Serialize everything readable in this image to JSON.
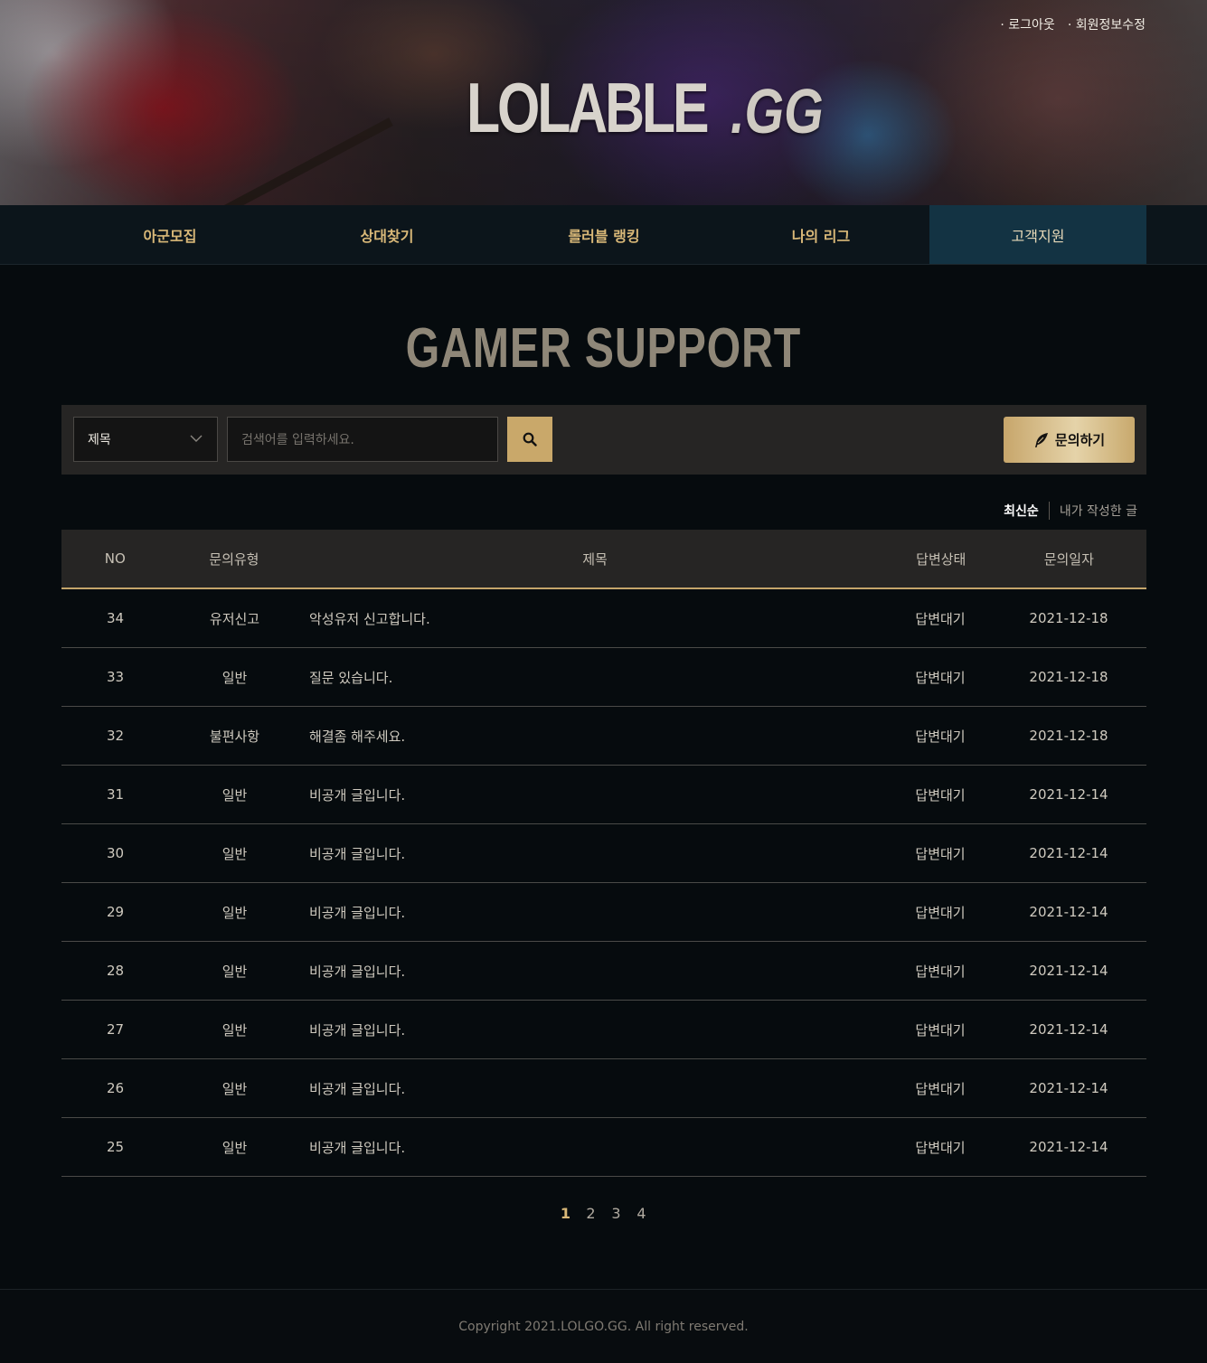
{
  "header": {
    "top_links": [
      "· 로그아웃",
      "· 회원정보수정"
    ],
    "logo_main": "LOLABLE",
    "logo_suffix": ".GG"
  },
  "nav": {
    "items": [
      "아군모집",
      "상대찾기",
      "롤러블 랭킹",
      "나의 리그",
      "고객지원"
    ],
    "active_index": 4
  },
  "page_title": "GAMER SUPPORT",
  "search": {
    "select_value": "제목",
    "placeholder": "검색어를 입력하세요.",
    "search_icon": "search-icon",
    "write_label": "문의하기",
    "write_icon": "quill-icon"
  },
  "sort": {
    "active": "최신순",
    "other": "내가 작성한 글"
  },
  "table": {
    "headers": [
      "NO",
      "문의유형",
      "제목",
      "답변상태",
      "문의일자"
    ],
    "rows": [
      {
        "no": "34",
        "type": "유저신고",
        "title": "악성유저 신고합니다.",
        "status": "답변대기",
        "date": "2021-12-18"
      },
      {
        "no": "33",
        "type": "일반",
        "title": "질문 있습니다.",
        "status": "답변대기",
        "date": "2021-12-18"
      },
      {
        "no": "32",
        "type": "불편사항",
        "title": "해결좀 해주세요.",
        "status": "답변대기",
        "date": "2021-12-18"
      },
      {
        "no": "31",
        "type": "일반",
        "title": "비공개 글입니다.",
        "status": "답변대기",
        "date": "2021-12-14"
      },
      {
        "no": "30",
        "type": "일반",
        "title": "비공개 글입니다.",
        "status": "답변대기",
        "date": "2021-12-14"
      },
      {
        "no": "29",
        "type": "일반",
        "title": "비공개 글입니다.",
        "status": "답변대기",
        "date": "2021-12-14"
      },
      {
        "no": "28",
        "type": "일반",
        "title": "비공개 글입니다.",
        "status": "답변대기",
        "date": "2021-12-14"
      },
      {
        "no": "27",
        "type": "일반",
        "title": "비공개 글입니다.",
        "status": "답변대기",
        "date": "2021-12-14"
      },
      {
        "no": "26",
        "type": "일반",
        "title": "비공개 글입니다.",
        "status": "답변대기",
        "date": "2021-12-14"
      },
      {
        "no": "25",
        "type": "일반",
        "title": "비공개 글입니다.",
        "status": "답변대기",
        "date": "2021-12-14"
      }
    ]
  },
  "pagination": {
    "pages": [
      "1",
      "2",
      "3",
      "4"
    ],
    "current": "1"
  },
  "footer": {
    "copyright": "Copyright 2021.LOLGO.GG. All right reserved."
  },
  "colors": {
    "accent_gold": "#c9a86a",
    "nav_active_bg": "#133343",
    "background": "#060b0e"
  }
}
